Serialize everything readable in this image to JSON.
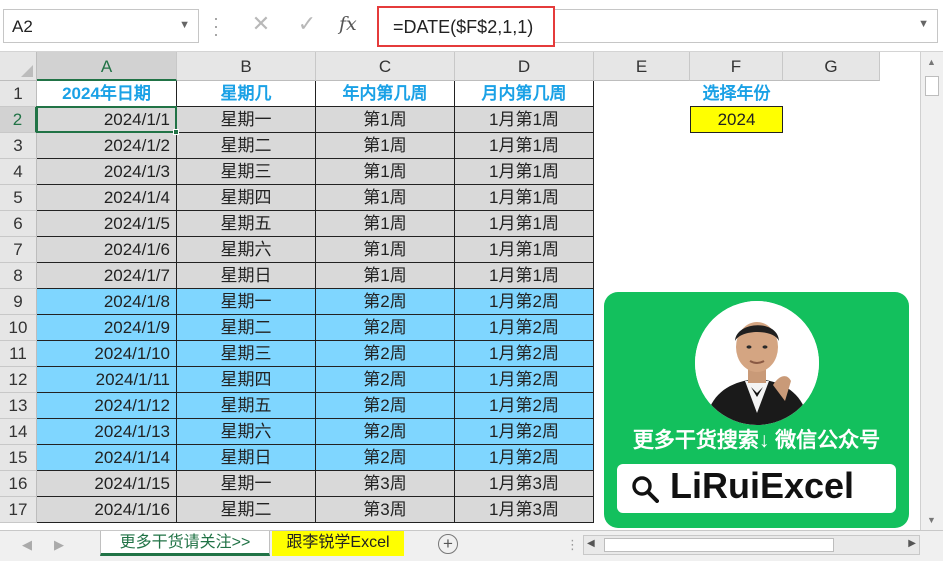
{
  "formula_bar": {
    "name_box": "A2",
    "cancel_symbol": "✕",
    "enter_symbol": "✓",
    "fx_label": "fx",
    "formula": "=DATE($F$2,1,1)"
  },
  "columns": [
    {
      "label": "A",
      "selected": true
    },
    {
      "label": "B",
      "selected": false
    },
    {
      "label": "C",
      "selected": false
    },
    {
      "label": "D",
      "selected": false
    },
    {
      "label": "E",
      "selected": false
    },
    {
      "label": "F",
      "selected": false
    },
    {
      "label": "G",
      "selected": false
    }
  ],
  "table": {
    "headers": [
      "2024年日期",
      "星期几",
      "年内第几周",
      "月内第几周"
    ],
    "rows": [
      {
        "row": "2",
        "date": "2024/1/1",
        "weekday": "星期一",
        "week_of_year": "第1周",
        "week_of_month": "1月第1周",
        "shade": "grey"
      },
      {
        "row": "3",
        "date": "2024/1/2",
        "weekday": "星期二",
        "week_of_year": "第1周",
        "week_of_month": "1月第1周",
        "shade": "grey"
      },
      {
        "row": "4",
        "date": "2024/1/3",
        "weekday": "星期三",
        "week_of_year": "第1周",
        "week_of_month": "1月第1周",
        "shade": "grey"
      },
      {
        "row": "5",
        "date": "2024/1/4",
        "weekday": "星期四",
        "week_of_year": "第1周",
        "week_of_month": "1月第1周",
        "shade": "grey"
      },
      {
        "row": "6",
        "date": "2024/1/5",
        "weekday": "星期五",
        "week_of_year": "第1周",
        "week_of_month": "1月第1周",
        "shade": "grey"
      },
      {
        "row": "7",
        "date": "2024/1/6",
        "weekday": "星期六",
        "week_of_year": "第1周",
        "week_of_month": "1月第1周",
        "shade": "grey"
      },
      {
        "row": "8",
        "date": "2024/1/7",
        "weekday": "星期日",
        "week_of_year": "第1周",
        "week_of_month": "1月第1周",
        "shade": "grey"
      },
      {
        "row": "9",
        "date": "2024/1/8",
        "weekday": "星期一",
        "week_of_year": "第2周",
        "week_of_month": "1月第2周",
        "shade": "blue"
      },
      {
        "row": "10",
        "date": "2024/1/9",
        "weekday": "星期二",
        "week_of_year": "第2周",
        "week_of_month": "1月第2周",
        "shade": "blue"
      },
      {
        "row": "11",
        "date": "2024/1/10",
        "weekday": "星期三",
        "week_of_year": "第2周",
        "week_of_month": "1月第2周",
        "shade": "blue"
      },
      {
        "row": "12",
        "date": "2024/1/11",
        "weekday": "星期四",
        "week_of_year": "第2周",
        "week_of_month": "1月第2周",
        "shade": "blue"
      },
      {
        "row": "13",
        "date": "2024/1/12",
        "weekday": "星期五",
        "week_of_year": "第2周",
        "week_of_month": "1月第2周",
        "shade": "blue"
      },
      {
        "row": "14",
        "date": "2024/1/13",
        "weekday": "星期六",
        "week_of_year": "第2周",
        "week_of_month": "1月第2周",
        "shade": "blue"
      },
      {
        "row": "15",
        "date": "2024/1/14",
        "weekday": "星期日",
        "week_of_year": "第2周",
        "week_of_month": "1月第2周",
        "shade": "blue"
      },
      {
        "row": "16",
        "date": "2024/1/15",
        "weekday": "星期一",
        "week_of_year": "第3周",
        "week_of_month": "1月第3周",
        "shade": "grey"
      },
      {
        "row": "17",
        "date": "2024/1/16",
        "weekday": "星期二",
        "week_of_year": "第3周",
        "week_of_month": "1月第3周",
        "shade": "grey"
      }
    ]
  },
  "year_selector": {
    "label": "选择年份",
    "value": "2024"
  },
  "promo": {
    "text": "更多干货搜索↓ 微信公众号",
    "handle": "LiRuiExcel"
  },
  "sheet_tabs": [
    {
      "label": "更多干货请关注>>",
      "active": true
    },
    {
      "label": "跟李锐学Excel",
      "active": false
    }
  ],
  "add_sheet_symbol": "+",
  "colors": {
    "header_text": "#1aa1e6",
    "grey_fill": "#d9d9d9",
    "blue_fill": "#7fd6ff",
    "year_fill": "#ffff00",
    "promo_green": "#13c05d",
    "excel_green": "#217346",
    "formula_highlight": "#e53b3b"
  },
  "icons": {
    "cancel": "cancel-icon",
    "enter": "enter-icon",
    "function": "insert-function-icon",
    "search": "search-icon",
    "add": "plus-circle-icon"
  }
}
